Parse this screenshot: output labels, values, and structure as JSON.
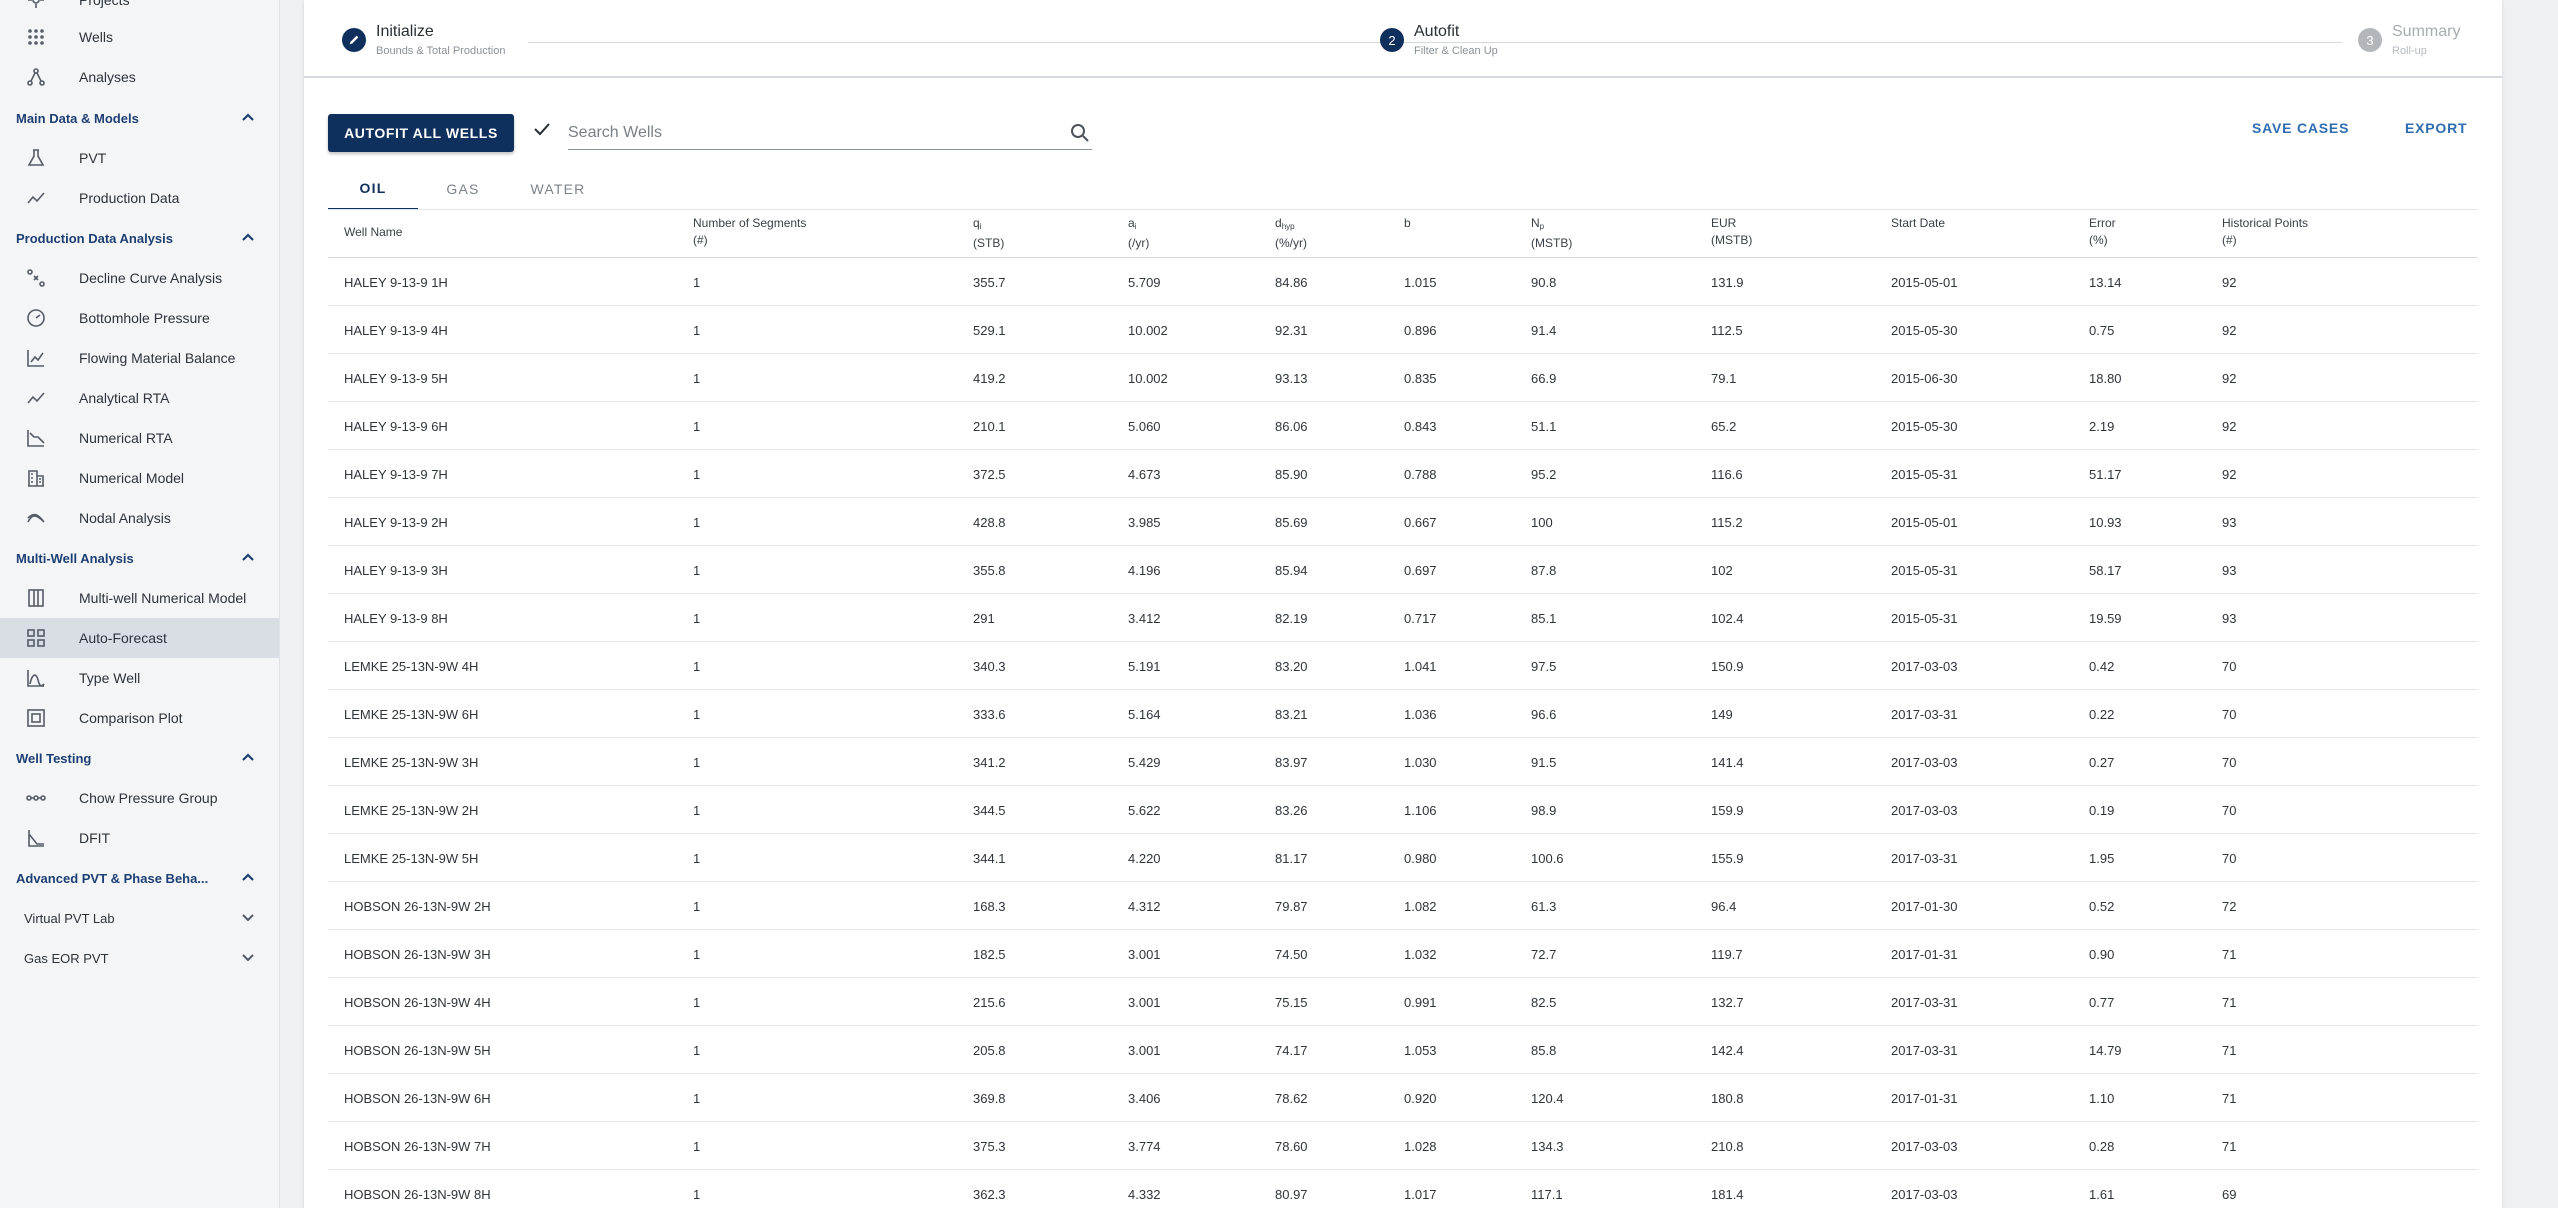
{
  "sidebar": {
    "top_items": [
      {
        "label": "Projects",
        "icon": "projects-icon"
      },
      {
        "label": "Wells",
        "icon": "wells-grid-icon"
      },
      {
        "label": "Analyses",
        "icon": "analyses-icon"
      }
    ],
    "sections": {
      "main_data": {
        "label": "Main Data & Models",
        "items": [
          {
            "label": "PVT",
            "icon": "flask-icon"
          },
          {
            "label": "Production Data",
            "icon": "trend-line-icon"
          }
        ]
      },
      "production_analysis": {
        "label": "Production Data Analysis",
        "items": [
          {
            "label": "Decline Curve Analysis",
            "icon": "decline-curve-icon"
          },
          {
            "label": "Bottomhole Pressure",
            "icon": "gauge-icon"
          },
          {
            "label": "Flowing Material Balance",
            "icon": "chart-axes-icon"
          },
          {
            "label": "Analytical RTA",
            "icon": "trend-line-icon"
          },
          {
            "label": "Numerical RTA",
            "icon": "numerical-rta-icon"
          },
          {
            "label": "Numerical Model",
            "icon": "building-icon"
          },
          {
            "label": "Nodal Analysis",
            "icon": "nodal-icon"
          }
        ]
      },
      "multi_well": {
        "label": "Multi-Well Analysis",
        "items": [
          {
            "label": "Multi-well Numerical Model",
            "icon": "columns-icon"
          },
          {
            "label": "Auto-Forecast",
            "icon": "dashboard-grid-icon"
          },
          {
            "label": "Type Well",
            "icon": "type-well-icon"
          },
          {
            "label": "Comparison Plot",
            "icon": "comparison-icon"
          }
        ]
      },
      "well_testing": {
        "label": "Well Testing",
        "items": [
          {
            "label": "Chow Pressure Group",
            "icon": "chain-icon"
          },
          {
            "label": "DFIT",
            "icon": "dfit-icon"
          }
        ]
      },
      "advanced_pvt": {
        "label": "Advanced PVT & Phase Beha...",
        "items": [
          {
            "label": "Virtual PVT Lab"
          },
          {
            "label": "Gas EOR PVT"
          }
        ]
      }
    }
  },
  "stepper": {
    "steps": [
      {
        "title": "Initialize",
        "subtitle": "Bounds & Total Production"
      },
      {
        "number": "2",
        "title": "Autofit",
        "subtitle": "Filter & Clean Up"
      },
      {
        "number": "3",
        "title": "Summary",
        "subtitle": "Roll-up"
      }
    ]
  },
  "toolbar": {
    "autofit_label": "AUTOFIT ALL WELLS",
    "search_placeholder": "Search Wells",
    "save_label": "SAVE CASES",
    "export_label": "EXPORT"
  },
  "tabs": [
    "OIL",
    "GAS",
    "WATER"
  ],
  "table": {
    "headers": [
      {
        "l1": "Well Name",
        "l2": ""
      },
      {
        "l1": "Number of Segments",
        "l2": "(#)"
      },
      {
        "l1": "q",
        "sub": "i",
        "l2": "(STB)"
      },
      {
        "l1": "a",
        "sub": "i",
        "l2": "(/yr)"
      },
      {
        "l1": "d",
        "sub": "hyp",
        "l2": "(%/yr)"
      },
      {
        "l1": "b",
        "l2": ""
      },
      {
        "l1": "N",
        "sub": "p",
        "l2": "(MSTB)"
      },
      {
        "l1": "EUR",
        "l2": "(MSTB)"
      },
      {
        "l1": "Start Date",
        "l2": ""
      },
      {
        "l1": "Error",
        "l2": "(%)"
      },
      {
        "l1": "Historical Points",
        "l2": "(#)"
      }
    ],
    "rows": [
      [
        "HALEY 9-13-9 1H",
        "1",
        "355.7",
        "5.709",
        "84.86",
        "1.015",
        "90.8",
        "131.9",
        "2015-05-01",
        "13.14",
        "92"
      ],
      [
        "HALEY 9-13-9 4H",
        "1",
        "529.1",
        "10.002",
        "92.31",
        "0.896",
        "91.4",
        "112.5",
        "2015-05-30",
        "0.75",
        "92"
      ],
      [
        "HALEY 9-13-9 5H",
        "1",
        "419.2",
        "10.002",
        "93.13",
        "0.835",
        "66.9",
        "79.1",
        "2015-06-30",
        "18.80",
        "92"
      ],
      [
        "HALEY 9-13-9 6H",
        "1",
        "210.1",
        "5.060",
        "86.06",
        "0.843",
        "51.1",
        "65.2",
        "2015-05-30",
        "2.19",
        "92"
      ],
      [
        "HALEY 9-13-9 7H",
        "1",
        "372.5",
        "4.673",
        "85.90",
        "0.788",
        "95.2",
        "116.6",
        "2015-05-31",
        "51.17",
        "92"
      ],
      [
        "HALEY 9-13-9 2H",
        "1",
        "428.8",
        "3.985",
        "85.69",
        "0.667",
        "100",
        "115.2",
        "2015-05-01",
        "10.93",
        "93"
      ],
      [
        "HALEY 9-13-9 3H",
        "1",
        "355.8",
        "4.196",
        "85.94",
        "0.697",
        "87.8",
        "102",
        "2015-05-31",
        "58.17",
        "93"
      ],
      [
        "HALEY 9-13-9 8H",
        "1",
        "291",
        "3.412",
        "82.19",
        "0.717",
        "85.1",
        "102.4",
        "2015-05-31",
        "19.59",
        "93"
      ],
      [
        "LEMKE 25-13N-9W 4H",
        "1",
        "340.3",
        "5.191",
        "83.20",
        "1.041",
        "97.5",
        "150.9",
        "2017-03-03",
        "0.42",
        "70"
      ],
      [
        "LEMKE 25-13N-9W 6H",
        "1",
        "333.6",
        "5.164",
        "83.21",
        "1.036",
        "96.6",
        "149",
        "2017-03-31",
        "0.22",
        "70"
      ],
      [
        "LEMKE 25-13N-9W 3H",
        "1",
        "341.2",
        "5.429",
        "83.97",
        "1.030",
        "91.5",
        "141.4",
        "2017-03-03",
        "0.27",
        "70"
      ],
      [
        "LEMKE 25-13N-9W 2H",
        "1",
        "344.5",
        "5.622",
        "83.26",
        "1.106",
        "98.9",
        "159.9",
        "2017-03-03",
        "0.19",
        "70"
      ],
      [
        "LEMKE 25-13N-9W 5H",
        "1",
        "344.1",
        "4.220",
        "81.17",
        "0.980",
        "100.6",
        "155.9",
        "2017-03-31",
        "1.95",
        "70"
      ],
      [
        "HOBSON 26-13N-9W 2H",
        "1",
        "168.3",
        "4.312",
        "79.87",
        "1.082",
        "61.3",
        "96.4",
        "2017-01-30",
        "0.52",
        "72"
      ],
      [
        "HOBSON 26-13N-9W 3H",
        "1",
        "182.5",
        "3.001",
        "74.50",
        "1.032",
        "72.7",
        "119.7",
        "2017-01-31",
        "0.90",
        "71"
      ],
      [
        "HOBSON 26-13N-9W 4H",
        "1",
        "215.6",
        "3.001",
        "75.15",
        "0.991",
        "82.5",
        "132.7",
        "2017-03-31",
        "0.77",
        "71"
      ],
      [
        "HOBSON 26-13N-9W 5H",
        "1",
        "205.8",
        "3.001",
        "74.17",
        "1.053",
        "85.8",
        "142.4",
        "2017-03-31",
        "14.79",
        "71"
      ],
      [
        "HOBSON 26-13N-9W 6H",
        "1",
        "369.8",
        "3.406",
        "78.62",
        "0.920",
        "120.4",
        "180.8",
        "2017-01-31",
        "1.10",
        "71"
      ],
      [
        "HOBSON 26-13N-9W 7H",
        "1",
        "375.3",
        "3.774",
        "78.60",
        "1.028",
        "134.3",
        "210.8",
        "2017-03-03",
        "0.28",
        "71"
      ],
      [
        "HOBSON 26-13N-9W 8H",
        "1",
        "362.3",
        "4.332",
        "80.97",
        "1.017",
        "117.1",
        "181.4",
        "2017-03-03",
        "1.61",
        "69"
      ]
    ]
  },
  "colors": {
    "primary": "#0f2f5c",
    "section": "#1d3f73",
    "link": "#2f6db0",
    "active_nav": "#d9dde4"
  }
}
